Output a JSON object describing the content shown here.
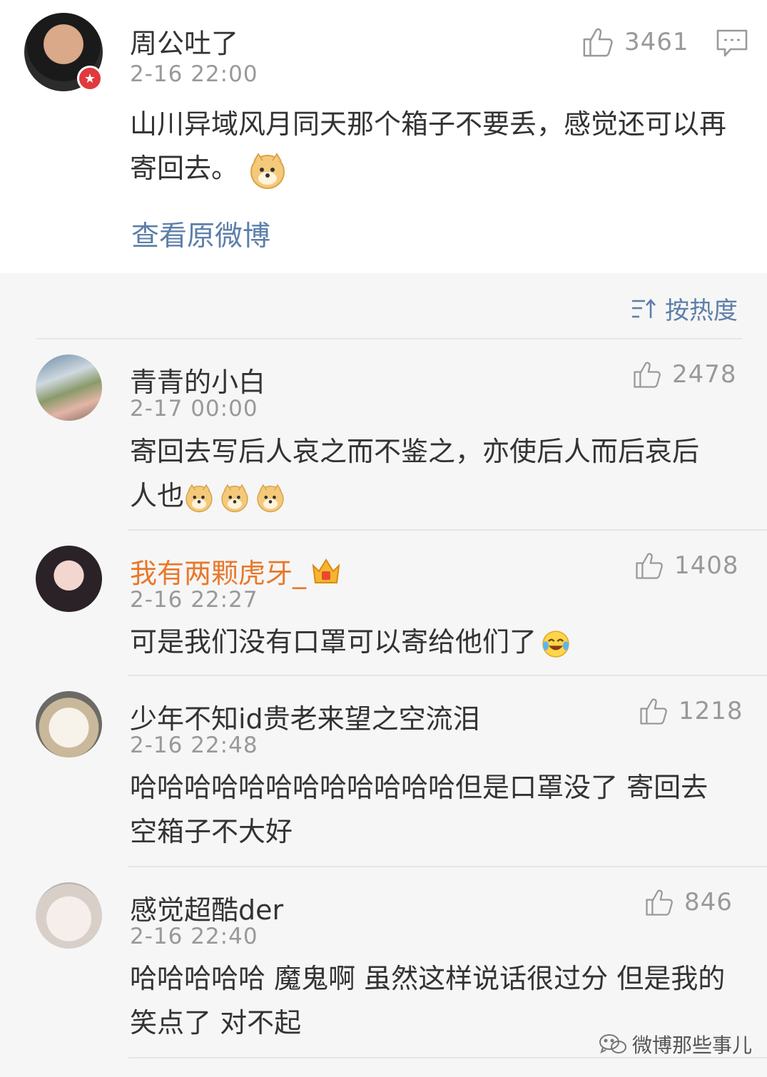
{
  "post": {
    "author": "周公吐了",
    "time": "2-16 22:00",
    "likes": "3461",
    "text": "山川异域风月同天那个箱子不要丢，感觉还可以再寄回去。",
    "view_original": "查看原微博"
  },
  "sort": {
    "label": "按热度"
  },
  "comments": [
    {
      "author": "青青的小白",
      "time": "2-17 00:00",
      "likes": "2478",
      "text": "寄回去写后人哀之而不鉴之，亦使后人而后哀后人也"
    },
    {
      "author": "我有两颗虎牙_",
      "time": "2-16 22:27",
      "likes": "1408",
      "text": "可是我们没有口罩可以寄给他们了"
    },
    {
      "author": "少年不知id贵老来望之空流泪",
      "time": "2-16 22:48",
      "likes": "1218",
      "text": "哈哈哈哈哈哈哈哈哈哈哈哈但是口罩没了 寄回去空箱子不大好"
    },
    {
      "author": "感觉超酷der",
      "time": "2-16 22:40",
      "likes": "846",
      "text": "哈哈哈哈哈 魔鬼啊 虽然这样说话很过分 但是我的笑点了 对不起"
    }
  ],
  "watermark": {
    "text": "微博那些事儿"
  },
  "colors": {
    "link": "#5d7fa8",
    "vip_name": "#e8782a",
    "muted": "#999999"
  }
}
